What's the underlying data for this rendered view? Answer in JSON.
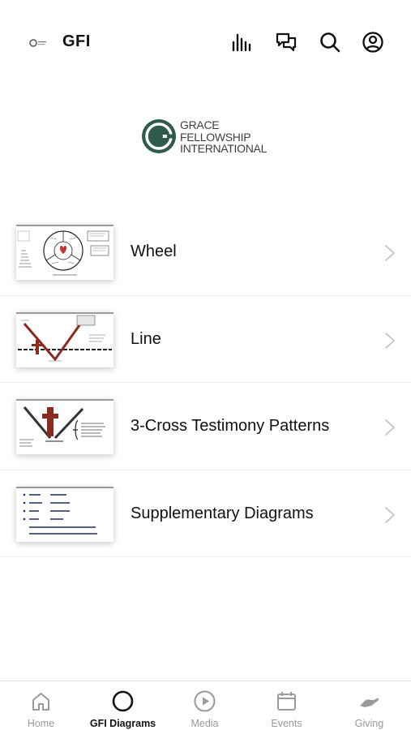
{
  "header": {
    "title": "GFI",
    "icons": [
      "bars-icon",
      "chat-icon",
      "search-icon",
      "profile-icon"
    ]
  },
  "brand": {
    "line1": "GRACE",
    "line2": "FELLOWSHIP",
    "line3": "INTERNATIONAL",
    "color": "#2f5a4e"
  },
  "list": {
    "items": [
      {
        "label": "Wheel",
        "thumb_caption": "Being to doing to do"
      },
      {
        "label": "Line",
        "thumb_caption": "In Christ"
      },
      {
        "label": "3-Cross Testimony Patterns",
        "thumb_caption": "Redemption"
      },
      {
        "label": "Supplementary Diagrams",
        "thumb_lines": [
          "Know  Rom. 6:3-6",
          "Reckon  Rom. 6:10,11",
          "Yield  Rom. 6:12,13",
          "Walk  Rom. 8:4"
        ]
      }
    ]
  },
  "tabbar": {
    "tabs": [
      {
        "label": "Home",
        "icon": "home-icon",
        "active": false
      },
      {
        "label": "GFI Diagrams",
        "icon": "circle-icon",
        "active": true
      },
      {
        "label": "Media",
        "icon": "play-icon",
        "active": false
      },
      {
        "label": "Events",
        "icon": "calendar-icon",
        "active": false
      },
      {
        "label": "Giving",
        "icon": "hand-icon",
        "active": false
      }
    ],
    "active_color": "#111111",
    "inactive_color": "#9a9a9a"
  }
}
